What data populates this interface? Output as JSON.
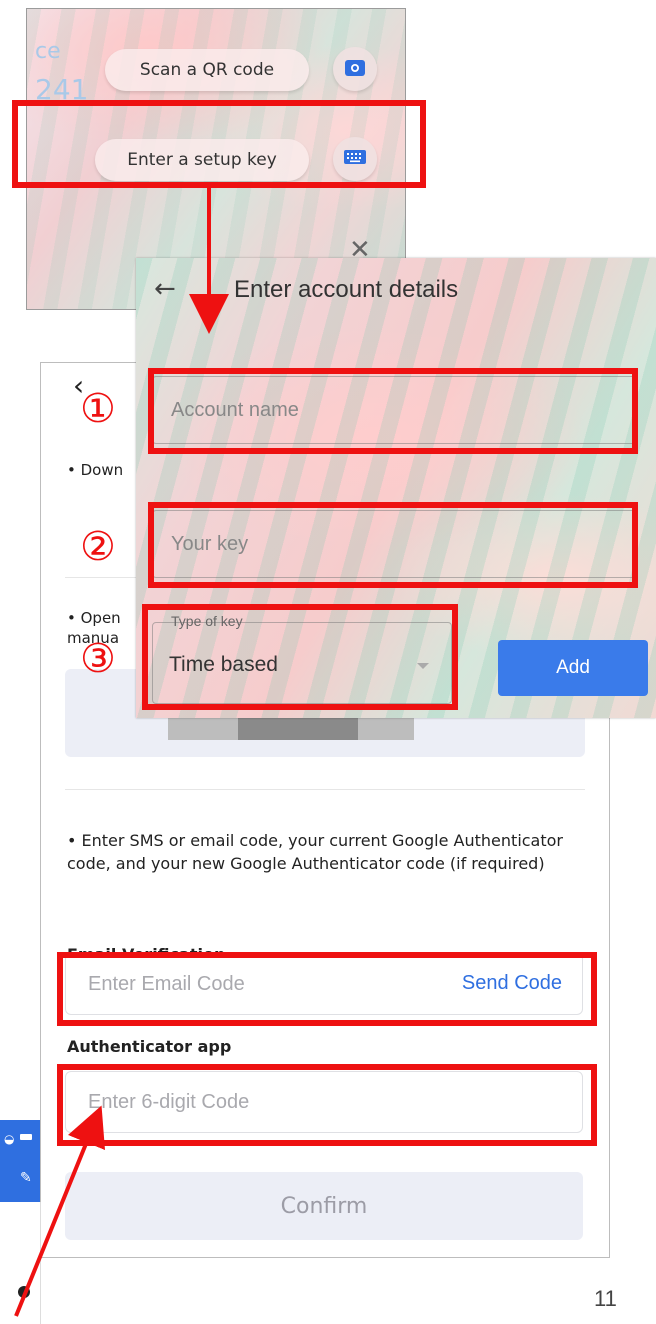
{
  "shot1": {
    "faded_text": "ce",
    "faded_number": "241",
    "scan_qr_label": "Scan a QR code",
    "setup_key_label": "Enter a setup key",
    "icons": [
      "camera-icon",
      "keyboard-icon",
      "close-icon"
    ]
  },
  "shot2": {
    "title": "Enter account details",
    "account_name_placeholder": "Account name",
    "your_key_placeholder": "Your key",
    "type_of_key_label": "Type of key",
    "type_of_key_value": "Time based",
    "add_label": "Add"
  },
  "shot3": {
    "bullet1_text": "• Down",
    "bullet2_line1": "• Open",
    "bullet2_line2": "manua",
    "instruction": "• Enter SMS or email code, your current Google Authenticator code, and your new Google Authenticator code (if required)",
    "email_label": "Email Verification",
    "email_placeholder": "Enter Email Code",
    "send_code_label": "Send Code",
    "auth_label": "Authenticator app",
    "auth_placeholder": "Enter 6-digit Code",
    "confirm_label": "Confirm"
  },
  "markers": [
    "①",
    "②",
    "③"
  ],
  "page_number": "11",
  "colors": {
    "highlight": "#ee1111",
    "accent_blue": "#2f6fe0",
    "add_button": "#3a7bea",
    "panel_grey": "#eceef6"
  }
}
